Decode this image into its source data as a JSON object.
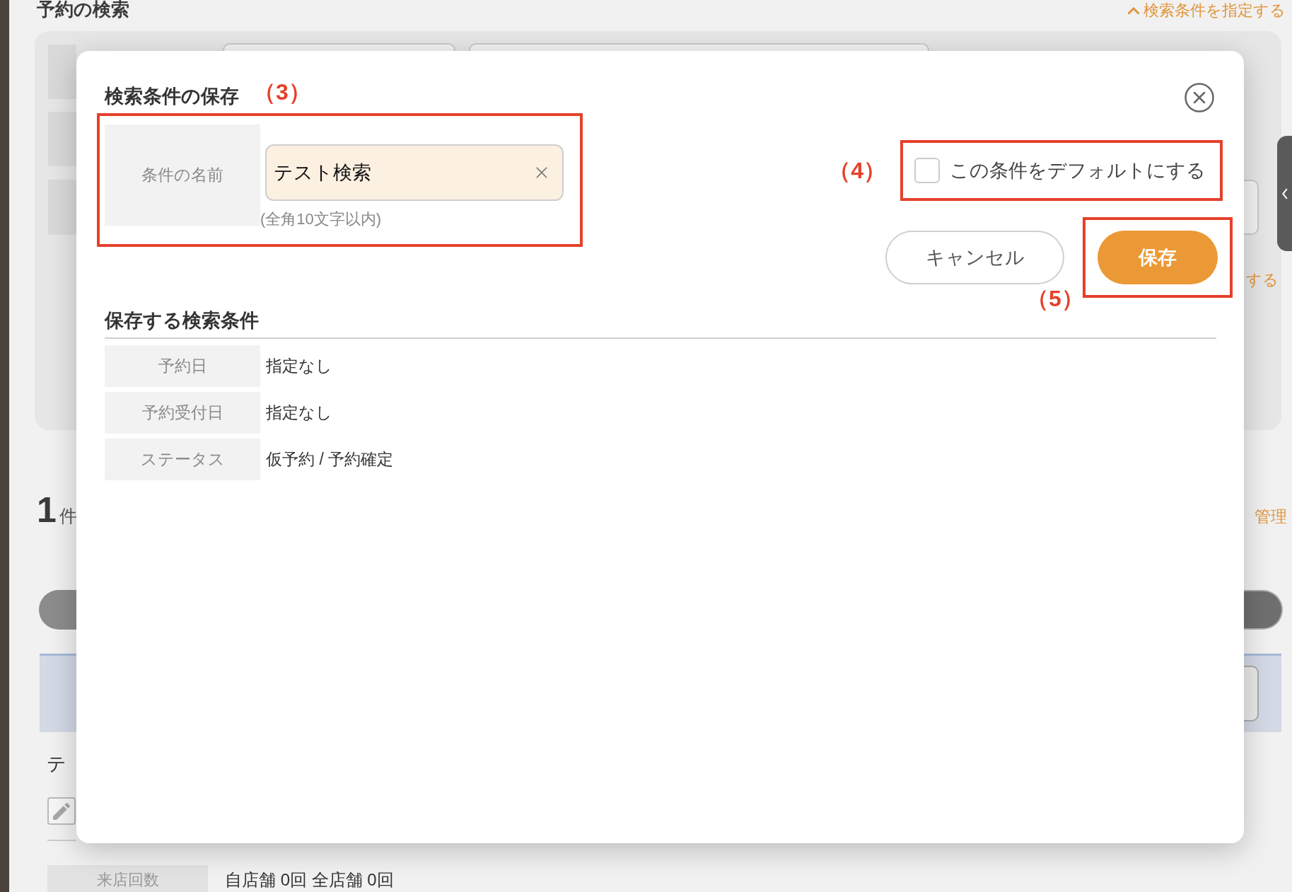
{
  "page": {
    "title": "予約の検索",
    "toggle_link": "検索条件を指定する",
    "panel_link": "する",
    "result_count": {
      "number": "1",
      "unit": "件"
    },
    "manage_link": "管理",
    "record_title": "テ",
    "visit_count": {
      "label": "来店回数",
      "value": "自店舗 0回 全店舗 0回"
    }
  },
  "dialog": {
    "title": "検索条件の保存",
    "name_field": {
      "label": "条件の名前",
      "value": "テスト検索",
      "hint": "(全角10文字以内)",
      "annotation": "（3）"
    },
    "default_checkbox": {
      "label": "この条件をデフォルトにする",
      "checked": false,
      "annotation": "（4）"
    },
    "buttons": [
      {
        "kind": "secondary",
        "label": "キャンセル"
      },
      {
        "kind": "primary",
        "label": "保存",
        "annotation": "（5）"
      }
    ],
    "section_title": "保存する検索条件",
    "conditions": [
      {
        "label": "予約日",
        "value": "指定なし"
      },
      {
        "label": "予約受付日",
        "value": "指定なし"
      },
      {
        "label": "ステータス",
        "value": "仮予約 / 予約確定"
      }
    ]
  }
}
